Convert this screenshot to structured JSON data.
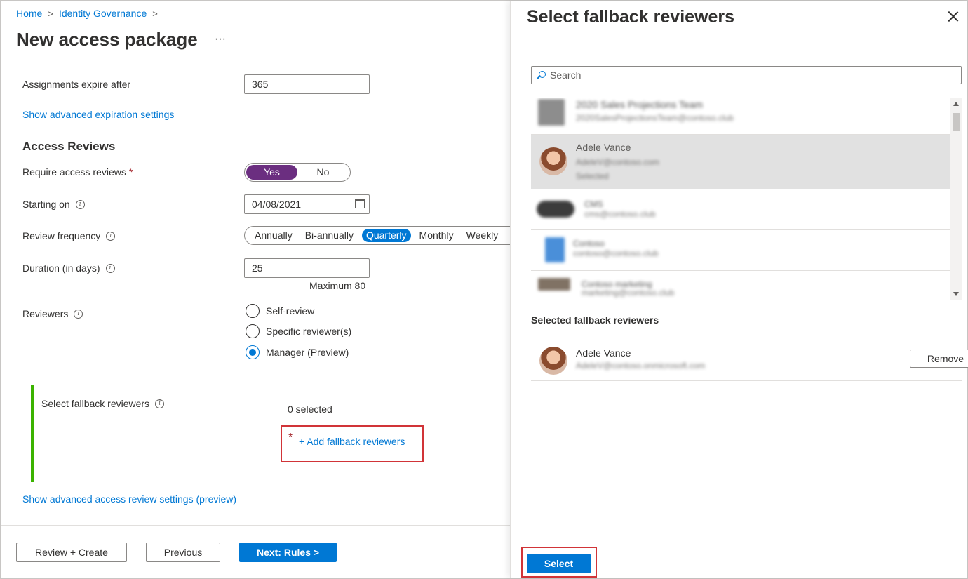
{
  "breadcrumb": {
    "home": "Home",
    "identity": "Identity Governance",
    "sep": ">"
  },
  "page": {
    "title": "New access package",
    "more": "···"
  },
  "expiration": {
    "label": "Assignments expire after",
    "value": "365",
    "advanced_link": "Show advanced expiration settings"
  },
  "access_reviews": {
    "title": "Access Reviews",
    "require_label": "Require access reviews",
    "required_mark": "*",
    "toggle": {
      "yes": "Yes",
      "no": "No",
      "selected": "Yes"
    },
    "starting_label": "Starting on",
    "starting_value": "04/08/2021",
    "frequency_label": "Review frequency",
    "frequency_options": [
      "Annually",
      "Bi-annually",
      "Quarterly",
      "Monthly",
      "Weekly"
    ],
    "frequency_selected": "Quarterly",
    "duration_label": "Duration (in days)",
    "duration_value": "25",
    "duration_hint": "Maximum 80",
    "reviewers_label": "Reviewers",
    "reviewer_options": [
      "Self-review",
      "Specific reviewer(s)",
      "Manager (Preview)"
    ],
    "reviewer_selected": "Manager (Preview)",
    "fallback_label": "Select fallback reviewers",
    "fallback_count": "0 selected",
    "fallback_required": "*",
    "fallback_add": "+ Add fallback reviewers",
    "advanced_link": "Show advanced access review settings (preview)"
  },
  "footer": {
    "review_create": "Review + Create",
    "previous": "Previous",
    "next": "Next: Rules >"
  },
  "panel": {
    "title": "Select fallback reviewers",
    "search_placeholder": "Search",
    "list": [
      {
        "name": "2020 Sales Projections Team",
        "sub": "2020SalesProjectionsTeam@contoso.club"
      },
      {
        "name": "Adele Vance",
        "sub": "AdeleV@contoso.com",
        "sub2": "Selected"
      },
      {
        "name": "CMS",
        "sub": "cms@contoso.club"
      },
      {
        "name": "Contoso",
        "sub": "contoso@contoso.club"
      },
      {
        "name": "Contoso marketing",
        "sub": "marketing@contoso.club"
      }
    ],
    "selected_title": "Selected fallback reviewers",
    "selected_person": {
      "name": "Adele Vance",
      "email": "AdeleV@contoso.onmicrosoft.com"
    },
    "remove_label": "Remove",
    "select_label": "Select"
  },
  "colors": {
    "accent": "#0078d4",
    "toggle_on": "#6b2e80",
    "green_bar": "#3bb300",
    "highlight": "#d13438"
  }
}
